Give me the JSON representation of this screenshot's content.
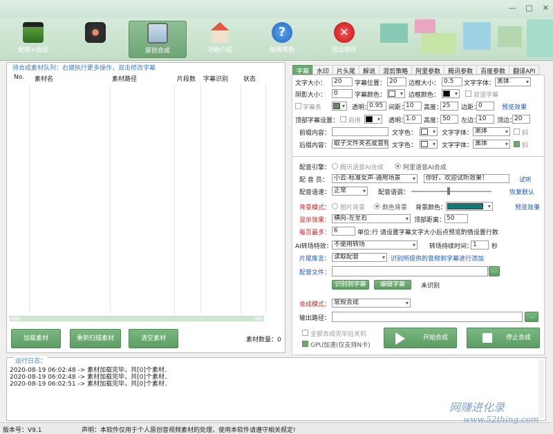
{
  "toolbar": {
    "buttons": [
      {
        "label": "配音+合成",
        "icon": "clapperboard-icon"
      },
      {
        "label": "",
        "icon": "film-reel-icon"
      },
      {
        "label": "原创合成",
        "icon": "image-frame-icon"
      },
      {
        "label": "功能介绍",
        "icon": "home-icon"
      },
      {
        "label": "使用帮助",
        "icon": "help-icon"
      },
      {
        "label": "退出软件",
        "icon": "exit-icon"
      }
    ]
  },
  "left": {
    "caption": "待合成素材队列：右键执行更多操作，双击修改字幕",
    "columns": [
      "No.",
      "素材名",
      "素材路径",
      "片段数",
      "字幕识别",
      "状态"
    ],
    "buttons": {
      "load": "加载素材",
      "rescan": "重新扫描素材",
      "clear": "清空素材"
    },
    "count_label": "素材数量：0"
  },
  "tabs": [
    "字幕",
    "水印",
    "片头尾",
    "解说",
    "混剪策略",
    "阿里参数",
    "腾讯参数",
    "百度参数",
    "翻译API"
  ],
  "subtitle": {
    "font_size_label": "文字大小：",
    "font_size": "20",
    "position_label": "字幕位置：",
    "position": "20",
    "border_size_label": "边框大小：",
    "border_size": "0.5",
    "font_label": "文字字体：",
    "font": "黑体",
    "shadow_label": "阴影大小：",
    "shadow": "0",
    "color_label": "字幕颜色：",
    "border_color_label": "边框颜色：",
    "bilingual_label": "双语字幕",
    "bar_label": "字幕条",
    "opacity_label": "透明：",
    "opacity": "0.95",
    "spacing_label": "间距：",
    "spacing": "10",
    "height_label": "高度：",
    "height": "25",
    "margin_label": "边距：",
    "margin": "0",
    "preview_label": "预览效果",
    "top_label": "顶部字幕设置：",
    "enable_label": "启用",
    "top_opacity": "1.0",
    "top_height": "50",
    "left_margin_label": "左边：",
    "left_margin": "10",
    "top_margin_label": "顶边：",
    "top_margin": "20",
    "prefix_label": "前缀内容：",
    "prefix": "",
    "text_color_label": "文字色：",
    "italic_label": "斜",
    "suffix_label": "后缀内容：",
    "suffix": "取子文件夹名或音频"
  },
  "audio": {
    "engine_label": "配音引擎：",
    "engine_tencent": "腾讯语音AI合成",
    "engine_ali": "阿里语音AI合成",
    "voice_label": "配 音 员：",
    "voice": "小云-标准女声-通用场景",
    "test_text": "你好，欢迎试听效果！",
    "test_label": "试听",
    "speed_label": "配音语速：",
    "speed": "正常",
    "tone_label": "配音语调：",
    "reset_label": "恢复默认",
    "bg_mode_label": "背景模式：",
    "bg_image": "图片背景",
    "bg_color": "颜色背景",
    "bg_color_label": "背景颜色：",
    "bg_preview": "预览效果",
    "effect_label": "显示效果：",
    "effect": "横向-左至右",
    "top_dist_label": "顶部距离：",
    "top_dist": "50",
    "lines_label": "每页最多：",
    "lines": "6",
    "lines_hint": "单位:行  请设置字幕文字大小后点预览酌情设置行数",
    "transition_label": "AI转场特效：",
    "transition": "不使用转场",
    "trans_time_label": "转场持续时间：",
    "trans_time": "1",
    "trans_unit": "秒",
    "library_label": "片尾库言：",
    "library": "读取配音",
    "library_hint": "识别所提供的音频到字幕进行添加",
    "audio_file_label": "配音文件：",
    "browse": "...",
    "recognize_btn": "识别到字幕",
    "edit_btn": "编辑字幕",
    "unrecognized": "未识别",
    "mode_label": "合成模式：",
    "mode": "常规合成",
    "output_label": "输出路径：",
    "shutdown_label": "全部合成完毕后关机",
    "gpu_label": "GPU加速(仅支持N卡)",
    "start_btn": "开始合成",
    "stop_btn": "停止合成"
  },
  "log": {
    "caption": "运行日志：",
    "lines": [
      "2020-08-19 06:02:48 -> 素材加载完毕，共[0]个素材．",
      "2020-08-19 06:02:48 -> 素材加载完毕，共[0]个素材．",
      "2020-08-19 06:02:51 -> 素材加载完毕，共[0]个素材．"
    ]
  },
  "status": {
    "version": "版本号：V9.1",
    "notice": "声明：本软件仅用于个人原创音视频素材的处理，使用本软件请遵守相关规定!"
  },
  "watermark": {
    "brand": "网赚进化录",
    "url": "www.52thing.com"
  },
  "colors": {
    "accent": "#6aa86f",
    "bg_swatch": "#0e7c7b",
    "red_label": "#d22222",
    "blue_link": "#1a56c4"
  }
}
